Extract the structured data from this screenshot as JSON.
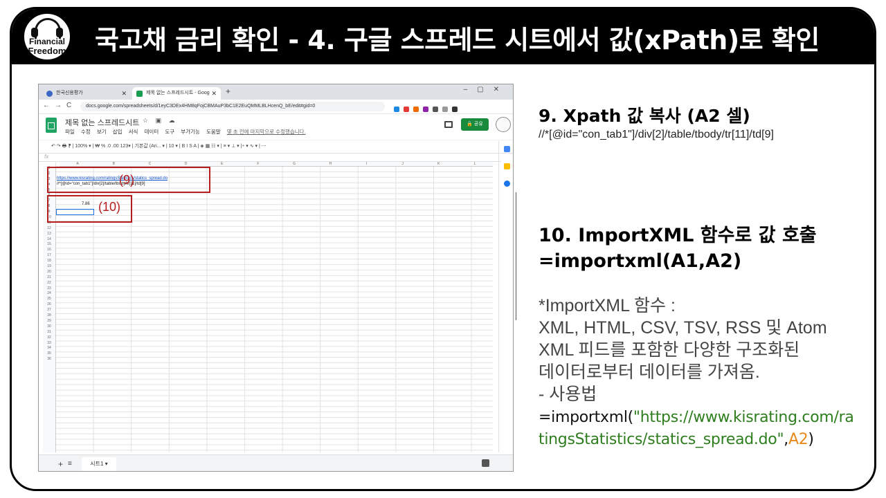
{
  "title": "국고채 금리 확인 - 4. 구글 스프레드 시트에서 값(xPath)로 확인",
  "logo": {
    "line1": "Financial",
    "line2": "Freedom"
  },
  "browser": {
    "tab1": "한국신용평가",
    "tab2": "제목 없는 스프레드시트 - Goog",
    "url": "docs.google.com/spreadsheets/d/1eyC3DEx4HM8qFojCBMAuP3bC1E2EuQMMLBLHcenQ_bE/edit#gid=0"
  },
  "sheet": {
    "doc_title": "제목 없는 스프레드시트",
    "menu": [
      "파일",
      "수정",
      "보기",
      "삽입",
      "서식",
      "데이터",
      "도구",
      "부가기능",
      "도움말"
    ],
    "last_edit": "몇 초 전에 마지막으로 수정했습니다.",
    "share": "공유",
    "toolbar": "↶  ↷  🖶  ⁋  |  100% ▾  |  ₩  %  .0  .00  123▾  |  기본값 (Ari... ▾  |  10 ▾  |  B  I  S  A  |  ◈  ▦  ☷ ▾  |  ≡ ▾  ⊥ ▾  |÷ ▾  ∿ ▾  |  ⋯",
    "fx": "fx",
    "columns": [
      "A",
      "B",
      "C",
      "D",
      "E",
      "F",
      "G",
      "H",
      "I",
      "J",
      "K",
      "L"
    ],
    "rows": [
      "1",
      "2",
      "3",
      "4",
      "5",
      "6",
      "7",
      "8",
      "9",
      "10",
      "11",
      "12",
      "13",
      "14",
      "15",
      "16",
      "17",
      "18",
      "19",
      "20",
      "21",
      "22",
      "23",
      "24",
      "25",
      "26",
      "27",
      "28",
      "29",
      "30",
      "31",
      "32",
      "33",
      "34",
      "35",
      "36"
    ],
    "a1": "https://www.kisrating.com/ratingsStatistics/statics_spread.do",
    "a2": "//*[@id=\"con_tab1\"]/div[2]/table/tbody/tr[11]/td[9]",
    "a4": "7.86",
    "sheet_tab": "시트1 ▾",
    "annot9": "(9)",
    "annot10": "(10)"
  },
  "step9": {
    "heading": "9. Xpath 값 복사 (A2 셀)",
    "xpath": "//*[@id=\"con_tab1\"]/div[2]/table/tbody/tr[11]/td[9]"
  },
  "step10": {
    "heading_line1": "10. ImportXML 함수로 값 호출",
    "heading_line2": "=importxml(A1,A2)",
    "desc1": "*ImportXML 함수 :",
    "desc2": "XML, HTML, CSV, TSV, RSS 및 Atom",
    "desc3": "XML 피드를 포함한 다양한 구조화된",
    "desc4": "데이터로부터 데이터를 가져옴.",
    "desc5": "- 사용법",
    "formula_prefix": "=importxml(",
    "formula_url1": "\"https://www.kisrating.com/ra",
    "formula_url2": "tingsStatistics/statics_spread.do\"",
    "formula_comma": ",",
    "formula_arg": "A2",
    "formula_close": ")"
  },
  "colors": {
    "title_bg": "#000000",
    "annotation_red": "#b71c1c",
    "sheets_green": "#1a8a3c",
    "url_green": "#2e7d1e",
    "arg_orange": "#e8891a"
  }
}
